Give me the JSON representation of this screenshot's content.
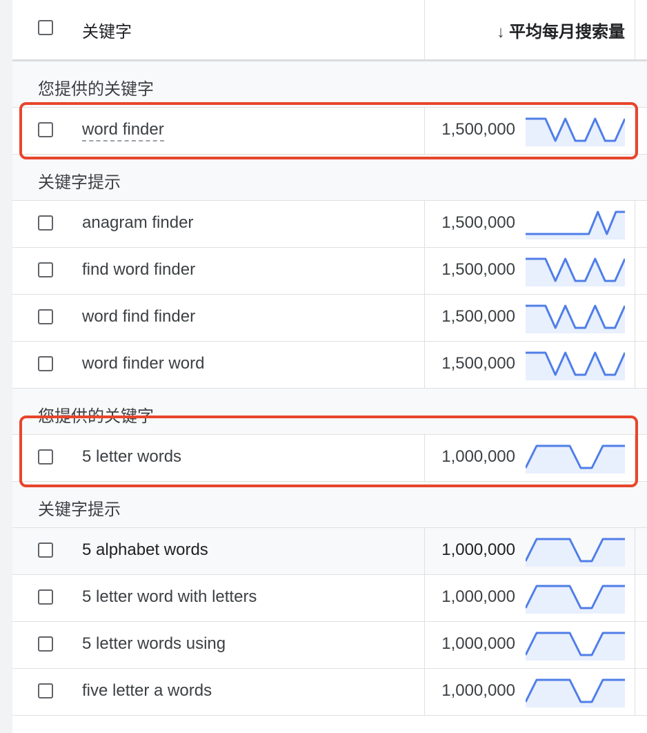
{
  "header": {
    "keyword_column": "关键字",
    "volume_column": "平均每月搜索量",
    "sort_icon": "arrow-down-icon"
  },
  "colors": {
    "highlight": "#e8452c",
    "sparkline": "#4f7ee8",
    "sparkline_fill": "#e8effd"
  },
  "sections": [
    {
      "label": "您提供的关键字",
      "rows": [
        {
          "keyword": "word finder",
          "volume": "1,500,000",
          "trend": [
            1,
            1,
            1,
            0,
            1,
            0,
            0,
            1,
            0,
            0,
            1
          ]
        }
      ]
    },
    {
      "label": "关键字提示",
      "rows": [
        {
          "keyword": "anagram finder",
          "volume": "1,500,000",
          "trend": [
            0,
            0,
            0,
            0,
            0,
            0,
            0,
            0,
            1,
            0,
            1,
            1
          ]
        },
        {
          "keyword": "find word finder",
          "volume": "1,500,000",
          "trend": [
            1,
            1,
            1,
            0,
            1,
            0,
            0,
            1,
            0,
            0,
            1
          ]
        },
        {
          "keyword": "word find finder",
          "volume": "1,500,000",
          "trend": [
            1,
            1,
            1,
            0,
            1,
            0,
            0,
            1,
            0,
            0,
            1
          ]
        },
        {
          "keyword": "word finder word",
          "volume": "1,500,000",
          "trend": [
            1,
            1,
            1,
            0,
            1,
            0,
            0,
            1,
            0,
            0,
            1
          ]
        }
      ]
    },
    {
      "label": "您提供的关键字",
      "rows": [
        {
          "keyword": "5 letter words",
          "volume": "1,000,000",
          "trend": [
            0,
            1,
            1,
            1,
            1,
            0,
            0,
            1,
            1,
            1
          ]
        }
      ]
    },
    {
      "label": "关键字提示",
      "rows": [
        {
          "keyword": "5 alphabet words",
          "volume": "1,000,000",
          "trend": [
            0,
            1,
            1,
            1,
            1,
            0,
            0,
            1,
            1,
            1
          ]
        },
        {
          "keyword": "5 letter word with letters",
          "volume": "1,000,000",
          "trend": [
            0,
            1,
            1,
            1,
            1,
            0,
            0,
            1,
            1,
            1
          ]
        },
        {
          "keyword": "5 letter words using",
          "volume": "1,000,000",
          "trend": [
            0,
            1,
            1,
            1,
            1,
            0,
            0,
            1,
            1,
            1
          ]
        },
        {
          "keyword": "five letter a words",
          "volume": "1,000,000",
          "trend": [
            0,
            1,
            1,
            1,
            1,
            0,
            0,
            1,
            1,
            1
          ]
        }
      ]
    }
  ]
}
